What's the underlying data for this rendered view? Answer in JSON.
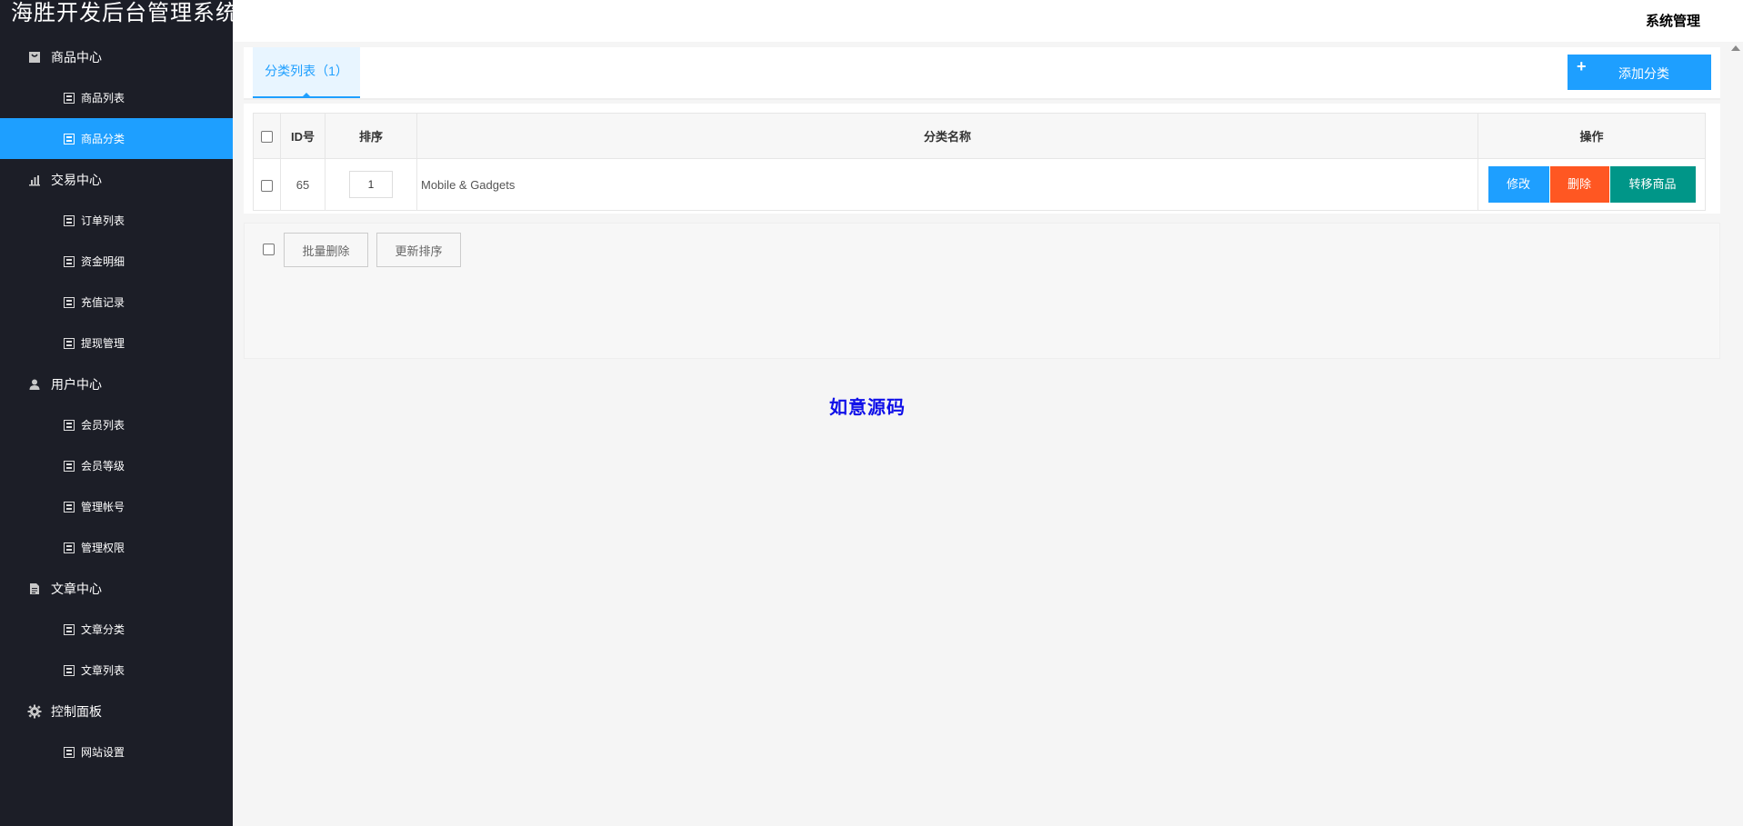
{
  "app": {
    "title": "海胜开发后台管理系统"
  },
  "header": {
    "system_menu": "系统管理"
  },
  "sidebar": {
    "groups": [
      {
        "label": "商品中心",
        "icon": "bag-icon",
        "items": [
          "商品列表",
          "商品分类"
        ]
      },
      {
        "label": "交易中心",
        "icon": "bar-chart-icon",
        "items": [
          "订单列表",
          "资金明细",
          "充值记录",
          "提现管理"
        ]
      },
      {
        "label": "用户中心",
        "icon": "user-icon",
        "items": [
          "会员列表",
          "会员等级",
          "管理帐号",
          "管理权限"
        ]
      },
      {
        "label": "文章中心",
        "icon": "document-icon",
        "items": [
          "文章分类",
          "文章列表"
        ]
      },
      {
        "label": "控制面板",
        "icon": "gear-icon",
        "items": [
          "网站设置"
        ]
      }
    ],
    "active_item": "商品分类"
  },
  "tabs": {
    "active_label": "分类列表（1）"
  },
  "toolbar": {
    "add_label": "添加分类"
  },
  "table": {
    "headers": {
      "id": "ID号",
      "sort": "排序",
      "name": "分类名称",
      "ops": "操作"
    },
    "rows": [
      {
        "id": "65",
        "sort": "1",
        "name": "Mobile & Gadgets",
        "edit": "修改",
        "delete": "删除",
        "move": "转移商品"
      }
    ]
  },
  "batch": {
    "delete_label": "批量删除",
    "update_sort_label": "更新排序"
  },
  "watermark": "如意源码",
  "colors": {
    "sidebar_bg": "#1c1e27",
    "accent": "#1e9fff",
    "danger": "#ff5722",
    "success": "#009688"
  }
}
